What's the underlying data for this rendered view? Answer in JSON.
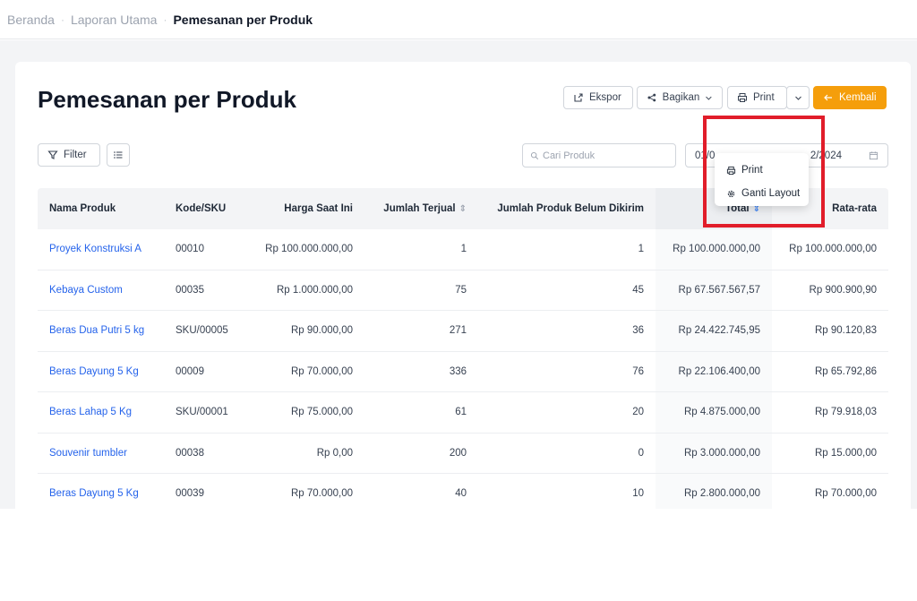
{
  "breadcrumb": {
    "home": "Beranda",
    "parent": "Laporan Utama",
    "current": "Pemesanan per Produk",
    "separator": "·"
  },
  "page": {
    "title": "Pemesanan per Produk"
  },
  "toolbar": {
    "export_label": "Ekspor",
    "share_label": "Bagikan",
    "print_label": "Print",
    "back_label": "Kembali"
  },
  "filters": {
    "filter_label": "Filter",
    "search_placeholder": "Cari Produk",
    "date_start": "01/0",
    "date_end": "2/2024"
  },
  "print_menu": {
    "items": [
      {
        "label": "Print",
        "icon": "printer-icon"
      },
      {
        "label": "Ganti Layout",
        "icon": "gear-icon"
      }
    ]
  },
  "table": {
    "headers": [
      "Nama Produk",
      "Kode/SKU",
      "Harga Saat Ini",
      "Jumlah Terjual",
      "Jumlah Produk Belum Dikirim",
      "Total",
      "Rata-rata"
    ],
    "rows": [
      [
        "Proyek Konstruksi A",
        "00010",
        "Rp 100.000.000,00",
        "1",
        "1",
        "Rp 100.000.000,00",
        "Rp 100.000.000,00"
      ],
      [
        "Kebaya Custom",
        "00035",
        "Rp 1.000.000,00",
        "75",
        "45",
        "Rp 67.567.567,57",
        "Rp 900.900,90"
      ],
      [
        "Beras Dua Putri 5 kg",
        "SKU/00005",
        "Rp 90.000,00",
        "271",
        "36",
        "Rp 24.422.745,95",
        "Rp 90.120,83"
      ],
      [
        "Beras Dayung 5 Kg",
        "00009",
        "Rp 70.000,00",
        "336",
        "76",
        "Rp 22.106.400,00",
        "Rp 65.792,86"
      ],
      [
        "Beras Lahap 5 Kg",
        "SKU/00001",
        "Rp 75.000,00",
        "61",
        "20",
        "Rp 4.875.000,00",
        "Rp 79.918,03"
      ],
      [
        "Souvenir tumbler",
        "00038",
        "Rp 0,00",
        "200",
        "0",
        "Rp 3.000.000,00",
        "Rp 15.000,00"
      ],
      [
        "Beras Dayung 5 Kg",
        "00039",
        "Rp 70.000,00",
        "40",
        "10",
        "Rp 2.800.000,00",
        "Rp 70.000,00"
      ]
    ]
  },
  "colors": {
    "accent": "#f59e0b",
    "link": "#2563eb",
    "highlight": "#e11d2a"
  }
}
